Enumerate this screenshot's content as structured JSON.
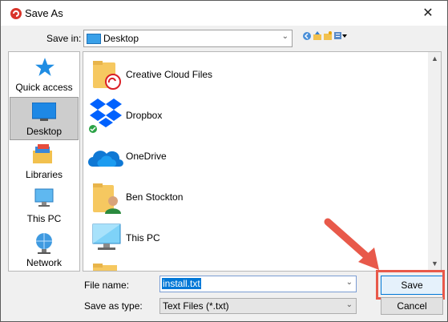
{
  "window": {
    "title": "Save As",
    "close_glyph": "✕"
  },
  "save_in": {
    "label": "Save in:",
    "value": "Desktop"
  },
  "places": [
    {
      "label": "Quick access",
      "icon": "star-icon"
    },
    {
      "label": "Desktop",
      "icon": "desktop-icon",
      "selected": true
    },
    {
      "label": "Libraries",
      "icon": "libraries-icon"
    },
    {
      "label": "This PC",
      "icon": "computer-icon"
    },
    {
      "label": "Network",
      "icon": "network-icon"
    }
  ],
  "files": [
    {
      "name": "Creative Cloud Files",
      "icon": "creative-cloud-folder-icon"
    },
    {
      "name": "Dropbox",
      "icon": "dropbox-icon"
    },
    {
      "name": "OneDrive",
      "icon": "onedrive-icon"
    },
    {
      "name": "Ben Stockton",
      "icon": "user-folder-icon"
    },
    {
      "name": "This PC",
      "icon": "computer-icon"
    }
  ],
  "form": {
    "file_name_label": "File name:",
    "file_name_value": "install.txt",
    "save_as_type_label": "Save as type:",
    "save_as_type_value": "Text Files (*.txt)"
  },
  "buttons": {
    "save": "Save",
    "cancel": "Cancel"
  },
  "colors": {
    "accent": "#0078d7",
    "highlight_annotation": "#e8594a"
  }
}
